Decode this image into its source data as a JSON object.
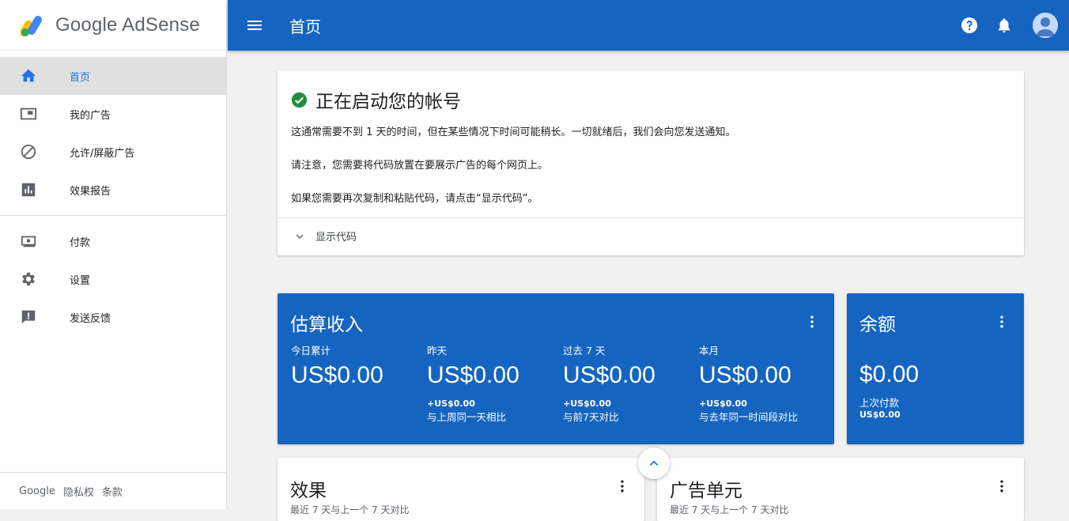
{
  "brand": {
    "name": "Google AdSense"
  },
  "sidebar": {
    "items": [
      {
        "label": "首页",
        "icon": "home-icon"
      },
      {
        "label": "我的广告",
        "icon": "ad-unit-icon"
      },
      {
        "label": "允许/屏蔽广告",
        "icon": "block-icon"
      },
      {
        "label": "效果报告",
        "icon": "bar-chart-icon"
      },
      {
        "label": "付款",
        "icon": "payment-icon"
      },
      {
        "label": "设置",
        "icon": "gear-icon"
      },
      {
        "label": "发送反馈",
        "icon": "feedback-icon"
      }
    ],
    "footer": {
      "google": "Google",
      "privacy": "隐私权",
      "terms": "条款"
    }
  },
  "header": {
    "title": "首页"
  },
  "setup": {
    "title": "正在启动您的帐号",
    "lines": [
      "这通常需要不到 1 天的时间，但在某些情况下时间可能稍长。一切就绪后，我们会向您发送通知。",
      "请注意，您需要将代码放置在要展示广告的每个网页上。",
      "如果您需要再次复制和粘贴代码，请点击“显示代码”。"
    ],
    "show_code": "显示代码"
  },
  "earnings": {
    "title": "估算收入",
    "metrics": [
      {
        "label": "今日累计",
        "value": "US$0.00",
        "delta": "",
        "compare": ""
      },
      {
        "label": "昨天",
        "value": "US$0.00",
        "delta": "+US$0.00",
        "compare": "与上周同一天相比"
      },
      {
        "label": "过去 7 天",
        "value": "US$0.00",
        "delta": "+US$0.00",
        "compare": "与前7天对比"
      },
      {
        "label": "本月",
        "value": "US$0.00",
        "delta": "+US$0.00",
        "compare": "与去年同一时间段对比"
      }
    ]
  },
  "balance": {
    "title": "余额",
    "value": "$0.00",
    "last_payment_label": "上次付款",
    "last_payment_value": "US$0.00"
  },
  "performance": {
    "title": "效果",
    "subtitle": "最近 7 天与上一个 7 天对比"
  },
  "ad_units": {
    "title": "广告单元",
    "subtitle": "最近 7 天与上一个 7 天对比"
  },
  "colors": {
    "primary": "#1565c0",
    "active_nav": "#1a73e8",
    "success": "#1e8e3e"
  }
}
